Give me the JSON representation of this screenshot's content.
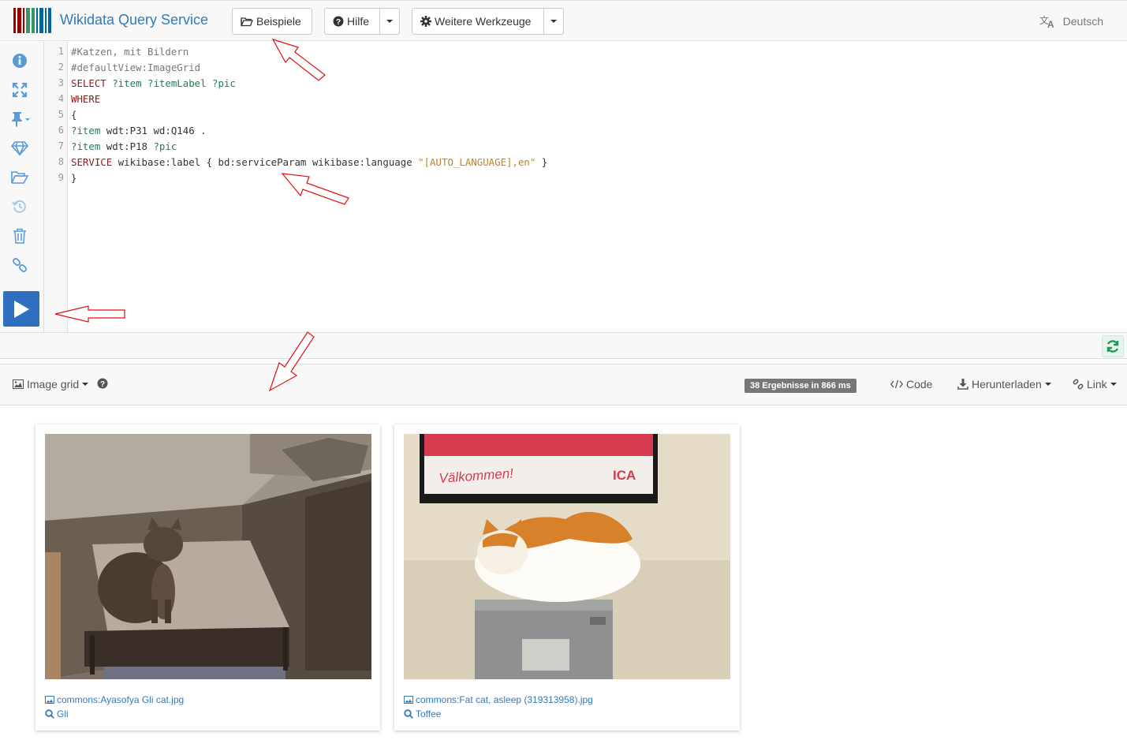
{
  "header": {
    "title": "Wikidata Query Service",
    "examples_label": "Beispiele",
    "help_label": "Hilfe",
    "tools_label": "Weitere Werkzeuge",
    "language": "Deutsch"
  },
  "sidebar": {
    "items": [
      "info-icon",
      "fullscreen-icon",
      "pin-icon",
      "gem-icon",
      "folder-open-icon",
      "history-icon",
      "trash-icon",
      "link-icon"
    ],
    "run": "play-icon"
  },
  "editor": {
    "lines": [
      "1",
      "2",
      "3",
      "4",
      "5",
      "6",
      "7",
      "8",
      "9"
    ],
    "line1": "#Katzen, mit Bildern",
    "line2": "#defaultView:ImageGrid",
    "line3_kw": "SELECT",
    "line3_vars": " ?item ?itemLabel ?pic",
    "line4": "WHERE",
    "line5": "{",
    "line6_var": "?item",
    "line6_rest": " wdt:P31 wd:Q146 .",
    "line7_var": "?item",
    "line7_mid": " wdt:P18 ",
    "line7_var2": "?pic",
    "line8_kw": "SERVICE",
    "line8_mid": " wikibase:label { bd:serviceParam wikibase:language ",
    "line8_str": "\"[AUTO_LANGUAGE],en\"",
    "line8_end": " }",
    "line9": "}"
  },
  "results": {
    "view_label": "Image grid",
    "badge": "38 Ergebnisse in 866 ms",
    "code_label": "Code",
    "download_label": "Herunterladen",
    "link_label": "Link",
    "items": [
      {
        "file": "commons:Ayasofya Gli cat.jpg",
        "label": "Gli"
      },
      {
        "file": "commons:Fat cat, asleep (319313958).jpg",
        "label": "Toffee"
      }
    ]
  },
  "colors": {
    "brand": "#337ab7",
    "run": "#2e6fc0",
    "annotation": "#e01010"
  }
}
